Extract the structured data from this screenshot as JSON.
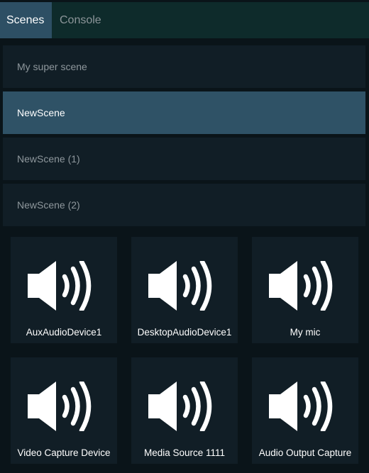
{
  "tabs": [
    {
      "label": "Scenes"
    },
    {
      "label": "Console"
    }
  ],
  "scenes": [
    {
      "label": "My super scene"
    },
    {
      "label": "NewScene"
    },
    {
      "label": "NewScene (1)"
    },
    {
      "label": "NewScene (2)"
    }
  ],
  "selected_scene": "NewScene",
  "sources": [
    {
      "label": "AuxAudioDevice1",
      "icon": "speaker-icon"
    },
    {
      "label": "DesktopAudioDevice1",
      "icon": "speaker-icon"
    },
    {
      "label": "My mic",
      "icon": "speaker-icon"
    },
    {
      "label": "Video Capture Device",
      "icon": "speaker-icon"
    },
    {
      "label": "Media Source 1111",
      "icon": "speaker-icon"
    },
    {
      "label": "Audio Output Capture",
      "icon": "speaker-icon"
    }
  ],
  "colors": {
    "background": "#0a1419",
    "tabbar": "#0e2b2b",
    "accent": "#2f5266",
    "panel": "#111e26"
  }
}
